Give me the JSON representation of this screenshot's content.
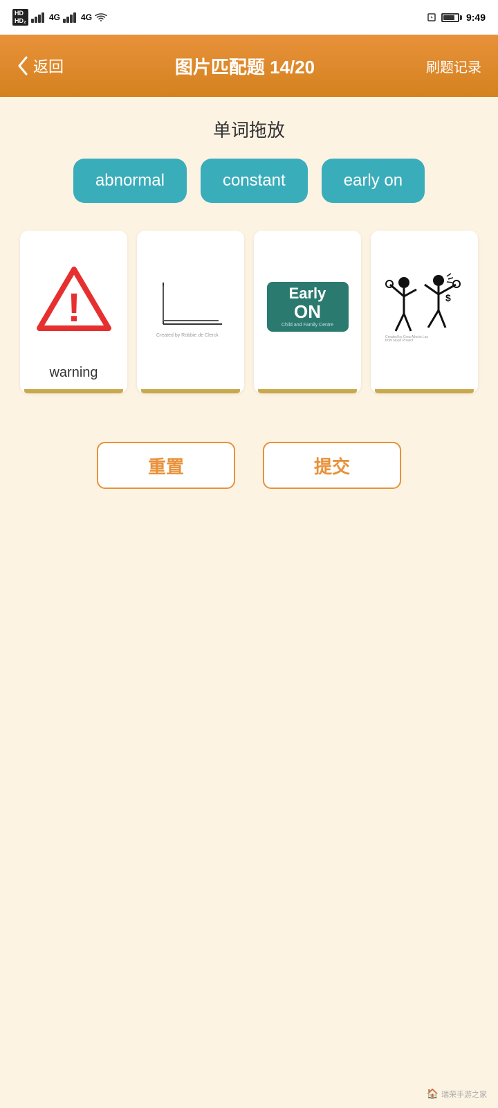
{
  "statusBar": {
    "time": "9:49",
    "hdLabel": "HD",
    "hd2Label": "HD₂"
  },
  "header": {
    "backLabel": "返回",
    "title": "图片匹配题 14/20",
    "recordLabel": "刷题记录"
  },
  "main": {
    "sectionTitle": "单词拖放",
    "wordChips": [
      {
        "id": "chip-abnormal",
        "label": "abnormal"
      },
      {
        "id": "chip-constant",
        "label": "constant"
      },
      {
        "id": "chip-early-on",
        "label": "early on"
      }
    ],
    "cards": [
      {
        "id": "card-warning",
        "type": "warning",
        "label": "warning"
      },
      {
        "id": "card-graph",
        "type": "graph",
        "label": ""
      },
      {
        "id": "card-earlyon",
        "type": "earlyon",
        "label": ""
      },
      {
        "id": "card-stickfig",
        "type": "stickfig",
        "label": ""
      }
    ],
    "buttons": {
      "reset": "重置",
      "submit": "提交"
    }
  },
  "footer": {
    "watermark": "瑞荣手游之家"
  }
}
